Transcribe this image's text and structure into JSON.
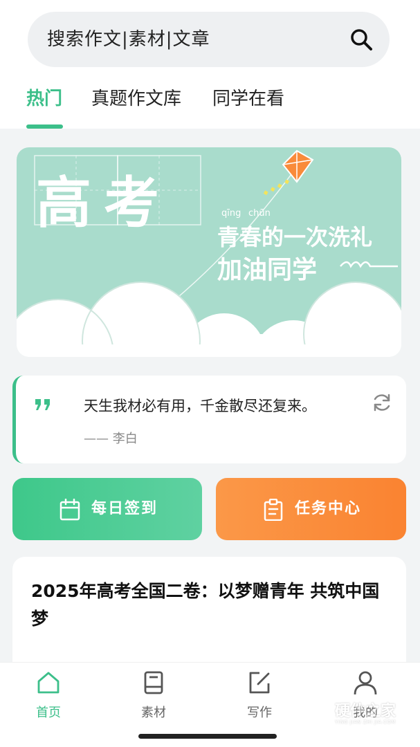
{
  "search": {
    "placeholder": "搜索作文|素材|文章"
  },
  "tabs": [
    {
      "label": "热门",
      "active": true
    },
    {
      "label": "真题作文库",
      "active": false
    },
    {
      "label": "同学在看",
      "active": false
    }
  ],
  "banner": {
    "main_text": "高考",
    "pinyin_1": "qīng",
    "pinyin_2": "chūn",
    "line_1": "青春的一次洗礼",
    "line_2": "加油同学"
  },
  "quote": {
    "text": "天生我材必有用，千金散尽还复来。",
    "author": "—— 李白",
    "mark": "❞"
  },
  "actions": {
    "sign_in": "每日签到",
    "task_center": "任务中心"
  },
  "article": {
    "title": "2025年高考全国二卷：以梦赠青年 共筑中国梦"
  },
  "nav": [
    {
      "label": "首页",
      "icon": "home-icon",
      "active": true
    },
    {
      "label": "素材",
      "icon": "book-icon",
      "active": false
    },
    {
      "label": "写作",
      "icon": "edit-icon",
      "active": false
    },
    {
      "label": "我的",
      "icon": "user-icon",
      "active": false
    }
  ],
  "watermark": {
    "text": "硬件之家",
    "sub": "YING JIAN ZHI JIA.COM"
  },
  "colors": {
    "accent": "#3cbf8a",
    "orange": "#fa8331",
    "banner_bg": "#a9dccc"
  }
}
